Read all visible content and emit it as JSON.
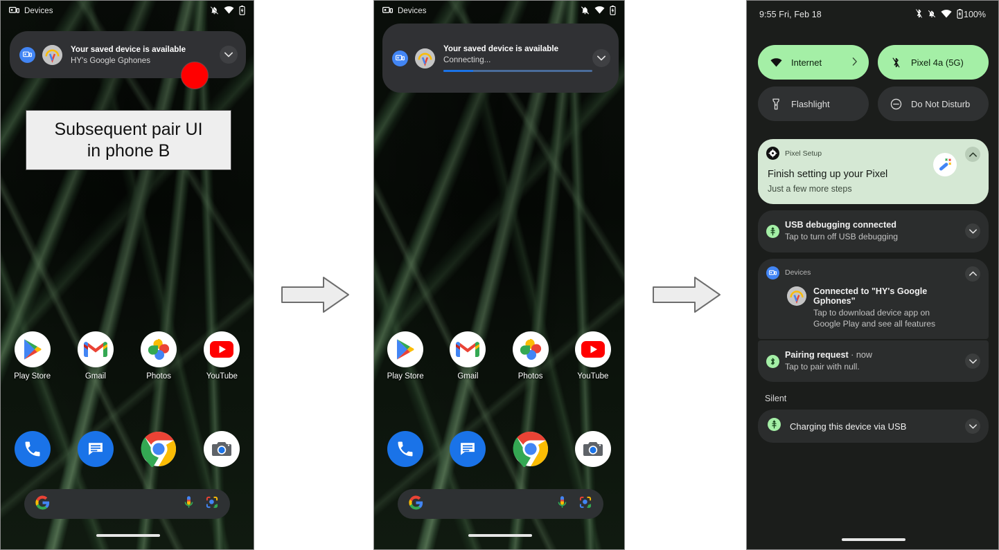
{
  "figure": {
    "callout": "Subsequent pair UI\nin phone B",
    "arrow_icon": "right-arrow-icon"
  },
  "phone_a": {
    "statusbar": {
      "app_label": "Devices",
      "icons": [
        "devices-icon",
        "notifications-muted-icon",
        "wifi-icon",
        "battery-icon"
      ]
    },
    "notification": {
      "app_icon": "devices-icon",
      "avatar": "device-avatar-icon",
      "title": "Your saved device is available",
      "subtitle": "HY's Google Gphones",
      "expand_icon": "chevron-down-icon"
    },
    "marker": {
      "name": "red-dot-marker",
      "color": "#ff0000"
    },
    "apps": [
      {
        "label": "Play Store",
        "icon": "play-store-icon"
      },
      {
        "label": "Gmail",
        "icon": "gmail-icon"
      },
      {
        "label": "Photos",
        "icon": "google-photos-icon"
      },
      {
        "label": "YouTube",
        "icon": "youtube-icon"
      }
    ],
    "dock": [
      {
        "label": "Phone",
        "icon": "phone-icon"
      },
      {
        "label": "Messages",
        "icon": "messages-icon"
      },
      {
        "label": "Chrome",
        "icon": "chrome-icon"
      },
      {
        "label": "Camera",
        "icon": "camera-icon"
      }
    ],
    "search": {
      "logo_icon": "google-g-icon",
      "mic_icon": "microphone-icon",
      "lens_icon": "google-lens-icon",
      "value": "",
      "placeholder": ""
    }
  },
  "phone_b": {
    "statusbar": {
      "app_label": "Devices",
      "icons": [
        "devices-icon",
        "notifications-muted-icon",
        "wifi-icon",
        "battery-icon"
      ]
    },
    "notification": {
      "app_icon": "devices-icon",
      "avatar": "device-avatar-icon",
      "title": "Your saved device is available",
      "subtitle": "Connecting...",
      "progress_percent": 20,
      "progress_color": "#1a73e8",
      "expand_icon": "chevron-down-icon"
    },
    "apps": [
      {
        "label": "Play Store",
        "icon": "play-store-icon"
      },
      {
        "label": "Gmail",
        "icon": "gmail-icon"
      },
      {
        "label": "Photos",
        "icon": "google-photos-icon"
      },
      {
        "label": "YouTube",
        "icon": "youtube-icon"
      }
    ],
    "dock": [
      {
        "label": "Phone",
        "icon": "phone-icon"
      },
      {
        "label": "Messages",
        "icon": "messages-icon"
      },
      {
        "label": "Chrome",
        "icon": "chrome-icon"
      },
      {
        "label": "Camera",
        "icon": "camera-icon"
      }
    ],
    "search": {
      "logo_icon": "google-g-icon",
      "mic_icon": "microphone-icon",
      "lens_icon": "google-lens-icon",
      "value": "",
      "placeholder": ""
    }
  },
  "phone_c": {
    "statusbar": {
      "clock": "9:55 Fri, Feb 18",
      "battery_percent": "100%",
      "icons": [
        "bluetooth-icon",
        "notifications-muted-icon",
        "wifi-icon",
        "battery-icon"
      ]
    },
    "quick_settings": [
      {
        "label": "Internet",
        "icon": "wifi-icon",
        "state": "on",
        "chevron": "chevron-right-icon"
      },
      {
        "label": "Pixel 4a (5G)",
        "icon": "bluetooth-icon",
        "state": "on"
      },
      {
        "label": "Flashlight",
        "icon": "flashlight-icon",
        "state": "off"
      },
      {
        "label": "Do Not Disturb",
        "icon": "do-not-disturb-icon",
        "state": "off"
      }
    ],
    "notifications": [
      {
        "app_name": "Pixel Setup",
        "app_icon": "pixel-setup-gear-icon",
        "title": "Finish setting up your Pixel",
        "body": "Just a few more steps",
        "thumb_icon": "magic-wand-icon",
        "expand_icon": "chevron-up-icon",
        "style": "highlight"
      },
      {
        "app_icon": "usb-icon",
        "title": "USB debugging connected",
        "body": "Tap to turn off USB debugging",
        "expand_icon": "chevron-down-icon"
      },
      {
        "app_name": "Devices",
        "app_icon": "devices-icon",
        "avatar": "device-avatar-icon",
        "title": "Connected to \"HY's Google Gphones\"",
        "body": "Tap to download device app on Google Play and see all features",
        "expand_icon": "chevron-up-icon"
      },
      {
        "app_icon": "bluetooth-icon",
        "title": "Pairing request",
        "when": " · now",
        "body": "Tap to pair with null.",
        "expand_icon": "chevron-down-icon"
      }
    ],
    "silent_section": {
      "label": "Silent",
      "items": [
        {
          "app_icon": "usb-icon",
          "title": "Charging this device via USB",
          "expand_icon": "chevron-down-icon"
        }
      ]
    }
  }
}
